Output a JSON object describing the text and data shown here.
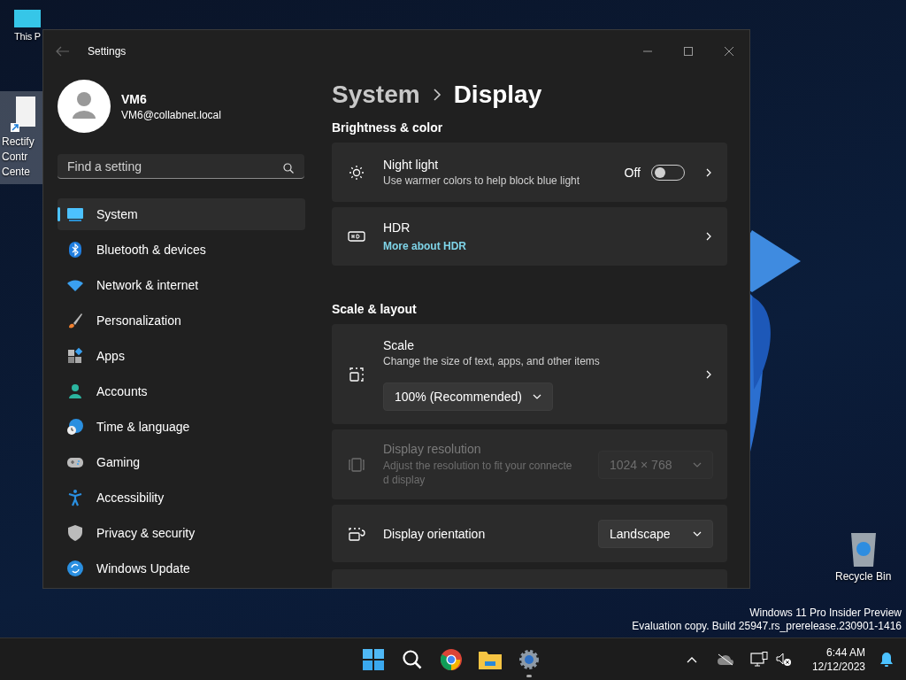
{
  "desktop_icons": [
    {
      "label": [
        "This P"
      ],
      "selected": false
    },
    {
      "label": [
        "Rectify",
        "Contr",
        "Cente"
      ],
      "selected": true
    },
    {
      "label": [
        "Recycle Bin"
      ],
      "selected": false
    }
  ],
  "window": {
    "title": "Settings"
  },
  "account": {
    "name": "VM6",
    "email": "VM6@collabnet.local"
  },
  "search": {
    "placeholder": "Find a setting"
  },
  "nav": {
    "items": [
      {
        "label": "System",
        "selected": true
      },
      {
        "label": "Bluetooth & devices",
        "selected": false
      },
      {
        "label": "Network & internet",
        "selected": false
      },
      {
        "label": "Personalization",
        "selected": false
      },
      {
        "label": "Apps",
        "selected": false
      },
      {
        "label": "Accounts",
        "selected": false
      },
      {
        "label": "Time & language",
        "selected": false
      },
      {
        "label": "Gaming",
        "selected": false
      },
      {
        "label": "Accessibility",
        "selected": false
      },
      {
        "label": "Privacy & security",
        "selected": false
      },
      {
        "label": "Windows Update",
        "selected": false
      }
    ]
  },
  "breadcrumb": [
    "System",
    "Display"
  ],
  "sections": [
    {
      "heading": "Brightness & color",
      "cards": [
        {
          "kind": "toggle",
          "title": "Night light",
          "description": "Use warmer colors to help block blue light",
          "state_label": "Off",
          "on": false
        },
        {
          "kind": "link",
          "title": "HDR",
          "link": "More about HDR"
        }
      ]
    },
    {
      "heading": "Scale & layout",
      "cards": [
        {
          "kind": "dropdown-below",
          "title": "Scale",
          "description": "Change the size of text, apps, and other items",
          "value": "100% (Recommended)"
        },
        {
          "kind": "dropdown",
          "title": "Display resolution",
          "description": "Adjust the resolution to fit your connected display",
          "value": "1024 × 768",
          "disabled": true
        },
        {
          "kind": "dropdown",
          "title": "Display orientation",
          "value": "Landscape",
          "disabled": false
        },
        {
          "kind": "partial"
        }
      ]
    }
  ],
  "build_info": [
    "Windows 11 Pro Insider Preview",
    "Evaluation copy. Build 25947.rs_prerelease.230901-1416"
  ],
  "taskbar": {
    "time": "6:44 AM",
    "date": "12/12/2023"
  }
}
